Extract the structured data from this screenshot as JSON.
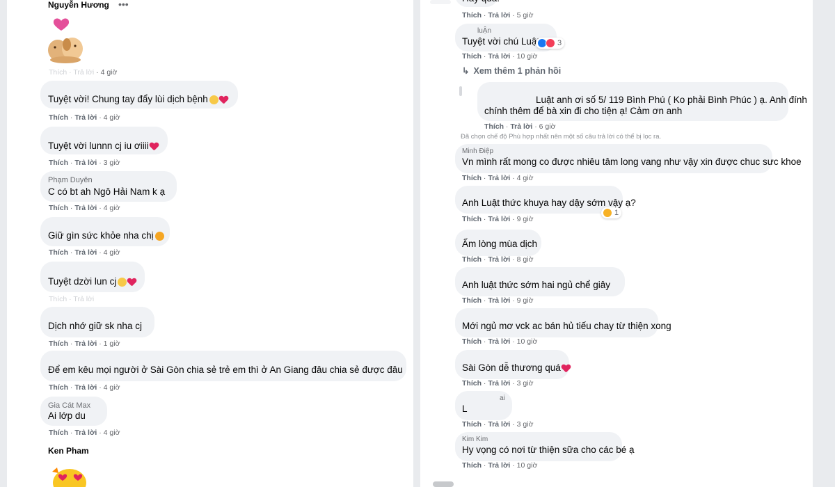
{
  "common": {
    "like": "Thích",
    "reply": "Trả lời"
  },
  "left": {
    "top_name": "Nguyễn Hương",
    "sticker_meta_time": "4 giờ",
    "comments": [
      {
        "text": "Tuyệt vời! Chung tay đẩy lùi dịch bệnh",
        "time": "4 giờ"
      },
      {
        "text": "Tuyệt vời lunnn cj iu ơiiii",
        "time": "3 giờ"
      },
      {
        "name": "Phạm Duyên",
        "text": "C có bt ah Ngô Hải Nam k ạ",
        "time": "4 giờ"
      },
      {
        "text": "Giữ gìn sức khỏe nha chị",
        "time": "4 giờ"
      },
      {
        "text": "Tuyệt dzời lun cj",
        "time": ""
      },
      {
        "text": "Dịch nhớ giữ sk nha cj",
        "time": "1 giờ"
      },
      {
        "text": "Để em kêu mọi người ở Sài Gòn chia sẻ trẻ em thì ở An Giang đâu chia sẻ được đâu",
        "time": "4 giờ"
      },
      {
        "name": "Gia Cát Max",
        "text": "Ai lớp du",
        "time": "4 giờ"
      }
    ],
    "bottom_name": "Ken Pham"
  },
  "right": {
    "c0": {
      "text": "Hay quá.",
      "time": "5 giờ"
    },
    "c1": {
      "name": "luẬn",
      "text": "Tuyệt vời chú Luật!",
      "time": "10 giờ",
      "reaction_count": "3"
    },
    "more_replies": "Xem thêm 1 phản hồi",
    "c2": {
      "line1": "Luật anh ơi số 5/ 119 Bình Phú ( Ko phải Bình Phúc ) ạ. Anh đính",
      "line2": "chính thêm để bà xin đi cho tiện ạ! Cảm ơn anh",
      "time": "6 giờ"
    },
    "filter_note": "Đã chọn chế độ Phù hợp nhất nên một số câu trả lời có thể bị lọc ra.",
    "comments": [
      {
        "name": "Minh Điệp",
        "text": "Vn mình rất mong co được nhiêu tâm long vang như vậy xin được chuc sưc khoe",
        "time": "4 giờ"
      },
      {
        "text": "Anh Luật thức khuya hay dậy sớm vậy ạ?",
        "time": "9 giờ",
        "reaction_count": "1"
      },
      {
        "text": "Ấm lòng mùa dịch",
        "time": "8 giờ"
      },
      {
        "text": "Anh luật thức sớm hai ngủ chể giây",
        "time": "9 giờ"
      },
      {
        "text": "Mới ngủ mơ vck ac bán hủ tiếu chay từ thiện xong",
        "time": "10 giờ"
      },
      {
        "text": "Sài Gòn dễ thương quá",
        "time": "3 giờ"
      },
      {
        "name": "ai",
        "text": "L",
        "time": "3 giờ"
      },
      {
        "name": "Kim Kim",
        "text": "Hy vọng có nơi từ thiện sữa cho các bé ạ",
        "time": "10 giờ"
      }
    ]
  },
  "colors": {
    "bubble": "#f0f2f5",
    "heart": "#e0245e",
    "like_blue": "#1877f2"
  }
}
